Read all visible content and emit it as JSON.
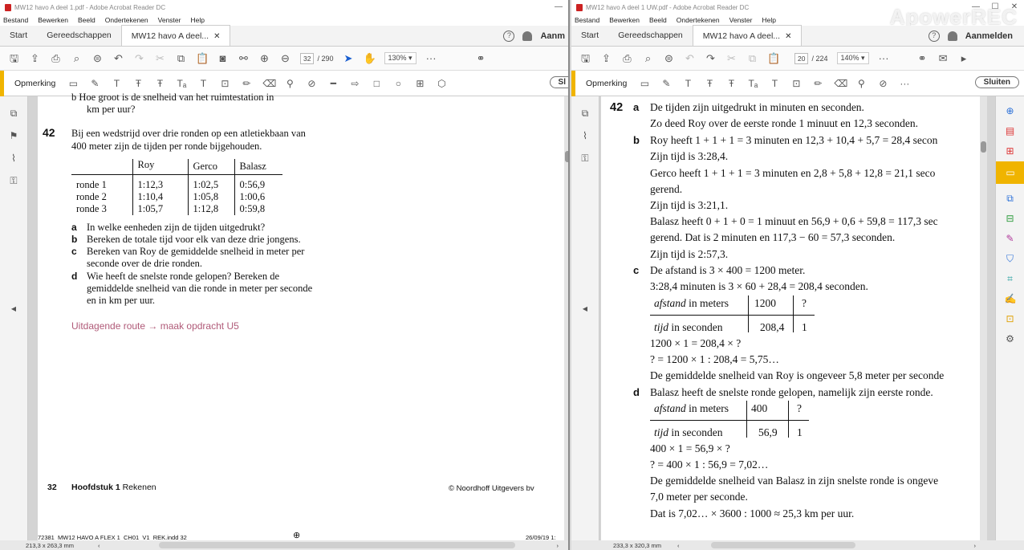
{
  "left": {
    "title": "MW12 havo A deel 1.pdf - Adobe Acrobat Reader DC",
    "menu": [
      "Bestand",
      "Bewerken",
      "Beeld",
      "Ondertekenen",
      "Venster",
      "Help"
    ],
    "tabs": [
      "Start",
      "Gereedschappen",
      "MW12 havo A deel..."
    ],
    "signin": "Aanm",
    "page_current": "32",
    "page_total": "/ 290",
    "zoom": "130%",
    "comment_label": "Opmerking",
    "close_label": "Sl",
    "content": {
      "prev_b_line1": "b   Hoe groot is de snelheid van het ruimtestation in",
      "prev_b_line2": "km per uur?",
      "q_num": "42",
      "q_text1": "Bij een wedstrijd over drie ronden op een atletiekbaan van",
      "q_text2": "400 meter zijn de tijden per ronde bijgehouden.",
      "table_headers": [
        "",
        "Roy",
        "Gerco",
        "Balasz"
      ],
      "table_rows": [
        [
          "ronde 1",
          "1:12,3",
          "1:02,5",
          "0:56,9"
        ],
        [
          "ronde 2",
          "1:10,4",
          "1:05,8",
          "1:00,6"
        ],
        [
          "ronde 3",
          "1:05,7",
          "1:12,8",
          "0:59,8"
        ]
      ],
      "qa": "In welke eenheden zijn de tijden uitgedrukt?",
      "qb": "Bereken de totale tijd voor elk van deze drie jongens.",
      "qc1": "Bereken van Roy de gemiddelde snelheid in meter per",
      "qc2": "seconde over de drie ronden.",
      "qd1": "Wie heeft de snelste ronde gelopen? Bereken de",
      "qd2": "gemiddelde snelheid van die ronde in meter per seconde",
      "qd3": "en in km per uur.",
      "route": "Uitdagende route → maak opdracht U5",
      "footer_page": "32",
      "footer_chapter": "Hoofdstuk 1",
      "footer_chapter_rest": "Rekenen",
      "footer_copy": "© Noordhoff Uitgevers bv",
      "slug_left": "72381_MW12 HAVO A FLEX 1_CH01_V1_REK.indd   32",
      "slug_right": "26/09/19   1:"
    },
    "page_size": "213,3 x 263,3 mm"
  },
  "right": {
    "title": "MW12 havo A deel 1 UW.pdf - Adobe Acrobat Reader DC",
    "menu": [
      "Bestand",
      "Bewerken",
      "Beeld",
      "Ondertekenen",
      "Venster",
      "Help"
    ],
    "tabs": [
      "Start",
      "Gereedschappen",
      "MW12 havo A deel..."
    ],
    "signin": "Aanmelden",
    "page_current": "20",
    "page_total": "/ 224",
    "zoom": "140%",
    "comment_label": "Opmerking",
    "close_label": "Sluiten",
    "watermark": "ApowerREC",
    "content": {
      "num": "42",
      "a1": "De tijden zijn uitgedrukt in minuten en seconden.",
      "a2": "Zo deed Roy over de eerste ronde 1 minuut en 12,3 seconden.",
      "b1": "Roy heeft 1 + 1 + 1 = 3 minuten en 12,3 + 10,4 + 5,7 = 28,4 secon",
      "b2": "Zijn tijd is 3:28,4.",
      "b3": "Gerco heeft 1 + 1 + 1 = 3 minuten en 2,8 + 5,8 + 12,8 = 21,1 seco",
      "b4": "gerend.",
      "b5": "Zijn tijd is 3:21,1.",
      "b6": "Balasz heeft 0 + 1 + 0 = 1 minuut en 56,9 + 0,6 + 59,8 = 117,3 sec",
      "b7": "gerend. Dat is 2 minuten en 117,3 − 60 = 57,3 seconden.",
      "b8": "Zijn tijd is 2:57,3.",
      "c1": "De afstand is 3 × 400 = 1200 meter.",
      "c2": "3:28,4 minuten is 3 × 60 + 28,4 = 208,4 seconden.",
      "ct_r1_label_i": "afstand",
      "ct_r1_label": " in meters",
      "ct_r1_v1": "1200",
      "ct_r1_v2": "?",
      "ct_r2_label_i": "tijd",
      "ct_r2_label": " in seconden",
      "ct_r2_v1": "208,4",
      "ct_r2_v2": "1",
      "c3": "1200 × 1 = 208,4 × ?",
      "c4": "? = 1200 × 1 : 208,4 = 5,75…",
      "c5": "De gemiddelde snelheid van Roy is ongeveer 5,8 meter per seconde",
      "d1": "Balasz heeft de snelste ronde gelopen, namelijk zijn eerste ronde.",
      "dt_r1_v1": "400",
      "dt_r1_v2": "?",
      "dt_r2_v1": "56,9",
      "dt_r2_v2": "1",
      "d2": "400 × 1 = 56,9 × ?",
      "d3": "? = 400 × 1 : 56,9 = 7,02…",
      "d4": "De gemiddelde snelheid van Balasz in zijn snelste ronde is ongeve",
      "d5": "7,0 meter per seconde.",
      "d6": "Dat is 7,02… × 3600 : 1000 ≈ 25,3 km per uur."
    },
    "page_size": "233,3 x 320,3 mm"
  }
}
